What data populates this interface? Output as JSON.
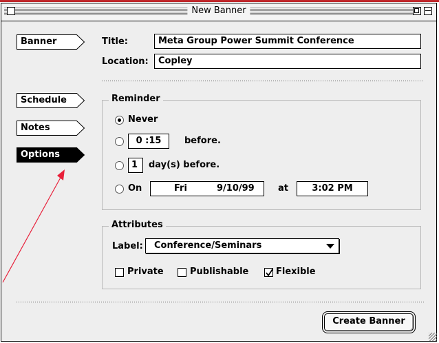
{
  "window": {
    "title": "New Banner"
  },
  "tabs": [
    {
      "label": "Banner",
      "selected": false
    },
    {
      "label": "Schedule",
      "selected": false
    },
    {
      "label": "Notes",
      "selected": false
    },
    {
      "label": "Options",
      "selected": true
    }
  ],
  "banner": {
    "title_label": "Title:",
    "title_value": "Meta Group Power Summit Conference",
    "location_label": "Location:",
    "location_value": "Copley"
  },
  "reminder": {
    "group_label": "Reminder",
    "selected": "never",
    "never_label": "Never",
    "time_value": "0 :15",
    "before_label": "before.",
    "days_value": "1",
    "days_label": "day(s) before.",
    "on_label": "On",
    "on_day": "Fri",
    "on_date": "9/10/99",
    "at_label": "at",
    "on_time": "3:02 PM"
  },
  "attributes": {
    "group_label": "Attributes",
    "label_label": "Label:",
    "label_value": "Conference/Seminars",
    "private_label": "Private",
    "private_checked": false,
    "publishable_label": "Publishable",
    "publishable_checked": false,
    "flexible_label": "Flexible",
    "flexible_checked": true
  },
  "create_button": "Create Banner",
  "colors": {
    "annotation_arrow": "#e8203a",
    "top_rule": "#c0282c"
  }
}
